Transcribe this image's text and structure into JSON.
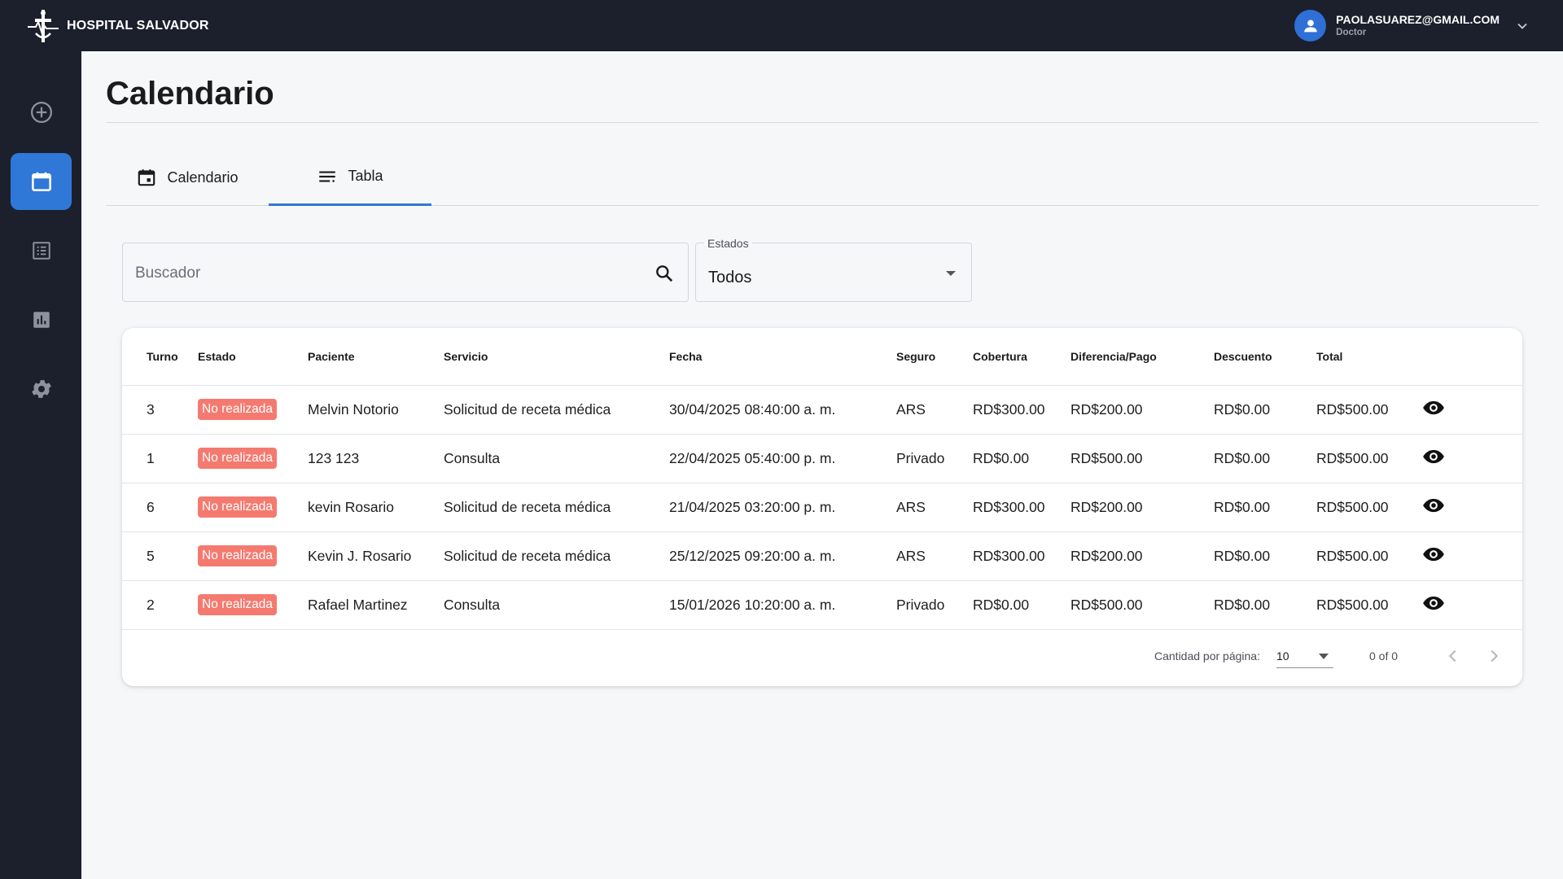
{
  "app": {
    "brand_name": "HOSPITAL SALVADOR"
  },
  "user": {
    "email": "PAOLASUAREZ@GMAIL.COM",
    "role": "Doctor"
  },
  "sidebar": {
    "items": [
      {
        "name": "add",
        "icon": "add-circle-icon",
        "active": false
      },
      {
        "name": "calendar",
        "icon": "calendar-icon",
        "active": true
      },
      {
        "name": "list",
        "icon": "list-icon",
        "active": false
      },
      {
        "name": "reports",
        "icon": "bar-chart-icon",
        "active": false
      },
      {
        "name": "settings",
        "icon": "gear-icon",
        "active": false
      }
    ]
  },
  "page": {
    "title": "Calendario"
  },
  "tabs": [
    {
      "label": "Calendario",
      "icon": "calendar-icon",
      "active": false
    },
    {
      "label": "Tabla",
      "icon": "list-lines-icon",
      "active": true
    }
  ],
  "filters": {
    "search_placeholder": "Buscador",
    "status_label": "Estados",
    "status_value": "Todos"
  },
  "table": {
    "headers": {
      "turno": "Turno",
      "estado": "Estado",
      "paciente": "Paciente",
      "servicio": "Servicio",
      "fecha": "Fecha",
      "seguro": "Seguro",
      "cobertura": "Cobertura",
      "diferencia": "Diferencia/Pago",
      "descuento": "Descuento",
      "total": "Total"
    },
    "rows": [
      {
        "turno": "3",
        "estado": "No realizada",
        "paciente": "Melvin Notorio",
        "servicio": "Solicitud de receta médica",
        "fecha": "30/04/2025 08:40:00 a. m.",
        "seguro": "ARS",
        "cobertura": "RD$300.00",
        "diferencia": "RD$200.00",
        "descuento": "RD$0.00",
        "total": "RD$500.00"
      },
      {
        "turno": "1",
        "estado": "No realizada",
        "paciente": "123 123",
        "servicio": "Consulta",
        "fecha": "22/04/2025 05:40:00 p. m.",
        "seguro": "Privado",
        "cobertura": "RD$0.00",
        "diferencia": "RD$500.00",
        "descuento": "RD$0.00",
        "total": "RD$500.00"
      },
      {
        "turno": "6",
        "estado": "No realizada",
        "paciente": "kevin Rosario",
        "servicio": "Solicitud de receta médica",
        "fecha": "21/04/2025 03:20:00 p. m.",
        "seguro": "ARS",
        "cobertura": "RD$300.00",
        "diferencia": "RD$200.00",
        "descuento": "RD$0.00",
        "total": "RD$500.00"
      },
      {
        "turno": "5",
        "estado": "No realizada",
        "paciente": "Kevin J. Rosario",
        "servicio": "Solicitud de receta médica",
        "fecha": "25/12/2025 09:20:00 a. m.",
        "seguro": "ARS",
        "cobertura": "RD$300.00",
        "diferencia": "RD$200.00",
        "descuento": "RD$0.00",
        "total": "RD$500.00"
      },
      {
        "turno": "2",
        "estado": "No realizada",
        "paciente": "Rafael Martinez",
        "servicio": "Consulta",
        "fecha": "15/01/2026 10:20:00 a. m.",
        "seguro": "Privado",
        "cobertura": "RD$0.00",
        "diferencia": "RD$500.00",
        "descuento": "RD$0.00",
        "total": "RD$500.00"
      }
    ]
  },
  "pagination": {
    "per_page_label": "Cantidad por página:",
    "per_page_value": "10",
    "range": "0 of 0"
  },
  "colors": {
    "sidebar_bg": "#1c202c",
    "accent": "#2f78d8",
    "badge_bg": "#f47a70"
  }
}
